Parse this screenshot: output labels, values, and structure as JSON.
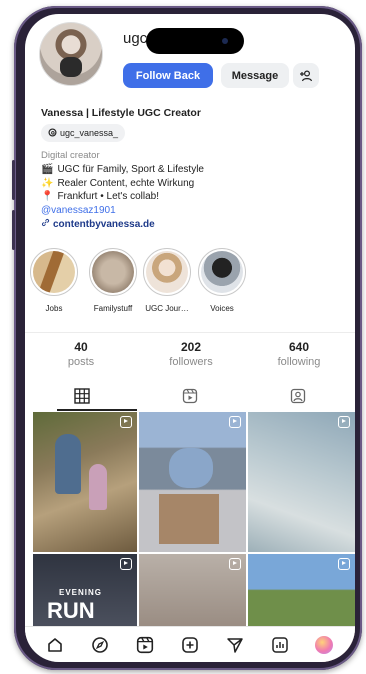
{
  "profile": {
    "username": "ugc_",
    "display_name": "Vanessa | Lifestyle UGC Creator",
    "threads_handle": "ugc_vanessa_",
    "category": "Digital creator",
    "bio_lines": [
      {
        "icon": "🎬",
        "text": "UGC für Family, Sport & Lifestyle"
      },
      {
        "icon": "✨",
        "text": "Realer Content, echte Wirkung"
      },
      {
        "icon": "📍",
        "text": "Frankfurt • Let's collab!"
      }
    ],
    "mention": "@vanessaz1901",
    "website": "contentbyvanessa.de"
  },
  "actions": {
    "follow_back": "Follow Back",
    "message": "Message",
    "add_person": "+👤"
  },
  "highlights": [
    {
      "label": "Jobs"
    },
    {
      "label": "Familystuff"
    },
    {
      "label": "UGC Jour…"
    },
    {
      "label": "Voices"
    }
  ],
  "stats": [
    {
      "value": "40",
      "label": "posts"
    },
    {
      "value": "202",
      "label": "followers"
    },
    {
      "value": "640",
      "label": "following"
    }
  ],
  "tabs": [
    "grid-icon",
    "reels-icon",
    "tagged-icon"
  ],
  "grid": {
    "tile_texts": [
      "EVENING",
      "RUN"
    ]
  },
  "bottom_nav": [
    "home-icon",
    "explore-icon",
    "reels-icon",
    "create-icon",
    "send-icon",
    "insights-icon",
    "profile-icon"
  ],
  "colors": {
    "accent": "#3f6fe8",
    "link": "#1e3a8a",
    "frame": "#2a2238"
  }
}
